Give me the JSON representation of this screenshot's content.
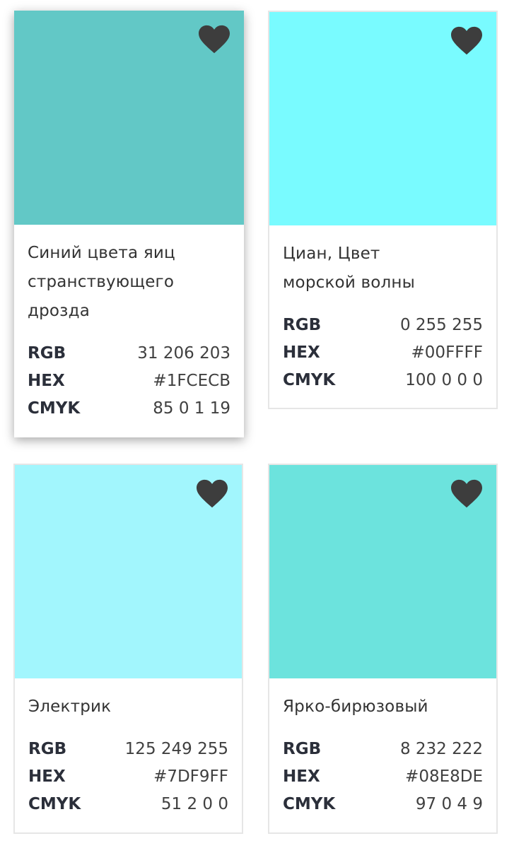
{
  "cards": [
    {
      "name": "Синий цвета яиц странствующего дрозда",
      "color": "#62C8C6",
      "rgb_label": "RGB",
      "rgb": "31 206 203",
      "hex_label": "HEX",
      "hex": "#1FCECB",
      "cmyk_label": "CMYK",
      "cmyk": "85 0 1 19",
      "icon": "heart-icon"
    },
    {
      "name": "Циан, Цвет морской волны",
      "color": "#79FBFF",
      "rgb_label": "RGB",
      "rgb": "0 255 255",
      "hex_label": "HEX",
      "hex": "#00FFFF",
      "cmyk_label": "CMYK",
      "cmyk": "100 0 0 0",
      "icon": "heart-icon"
    },
    {
      "name": "Электрик",
      "color": "#A2F6FD",
      "rgb_label": "RGB",
      "rgb": "125 249 255",
      "hex_label": "HEX",
      "hex": "#7DF9FF",
      "cmyk_label": "CMYK",
      "cmyk": "51 2 0 0",
      "icon": "heart-icon"
    },
    {
      "name": "Ярко-бирюзовый",
      "color": "#6CE3DD",
      "rgb_label": "RGB",
      "rgb": "8 232 222",
      "hex_label": "HEX",
      "hex": "#08E8DE",
      "cmyk_label": "CMYK",
      "cmyk": "97 0 4 9",
      "icon": "heart-icon"
    }
  ],
  "heart_color": "#3d3d3d"
}
